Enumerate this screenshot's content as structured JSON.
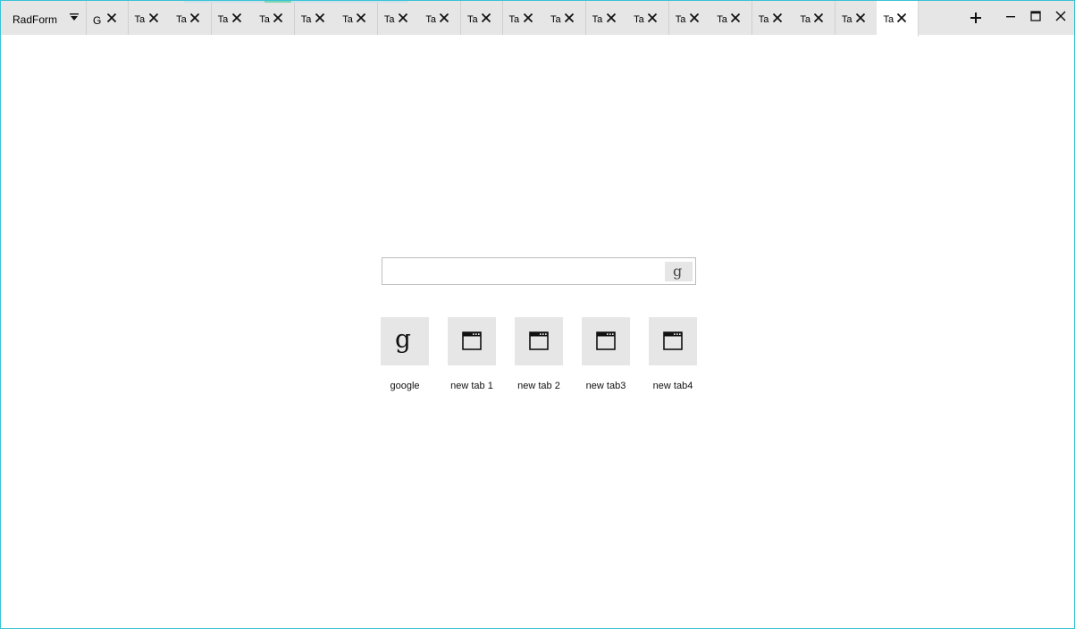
{
  "app": {
    "title": "RadForm"
  },
  "tabs": [
    {
      "label": "G"
    },
    {
      "label": "Ta"
    },
    {
      "label": "Ta"
    },
    {
      "label": "Ta"
    },
    {
      "label": "Ta"
    },
    {
      "label": "Ta"
    },
    {
      "label": "Ta"
    },
    {
      "label": "Ta"
    },
    {
      "label": "Ta"
    },
    {
      "label": "Ta"
    },
    {
      "label": "Ta"
    },
    {
      "label": "Ta"
    },
    {
      "label": "Ta"
    },
    {
      "label": "Ta"
    },
    {
      "label": "Ta"
    },
    {
      "label": "Ta"
    },
    {
      "label": "Ta"
    },
    {
      "label": "Ta"
    },
    {
      "label": "Ta"
    },
    {
      "label": "Ta"
    }
  ],
  "active_tab_index": 19,
  "search": {
    "value": "",
    "placeholder": "",
    "button_icon": "google-g-icon"
  },
  "shortcuts": [
    {
      "label": "google",
      "icon": "google-g-icon"
    },
    {
      "label": "new tab 1",
      "icon": "window-icon"
    },
    {
      "label": "new tab 2",
      "icon": "window-icon"
    },
    {
      "label": "new tab3",
      "icon": "window-icon"
    },
    {
      "label": "new tab4",
      "icon": "window-icon"
    }
  ],
  "icons": {
    "google_glyph": "g"
  },
  "colors": {
    "window_border": "#3ac3d6",
    "tab_bg": "#e6e6e6",
    "active_tab_bg": "#ffffff",
    "tile_bg": "#e6e6e6"
  }
}
